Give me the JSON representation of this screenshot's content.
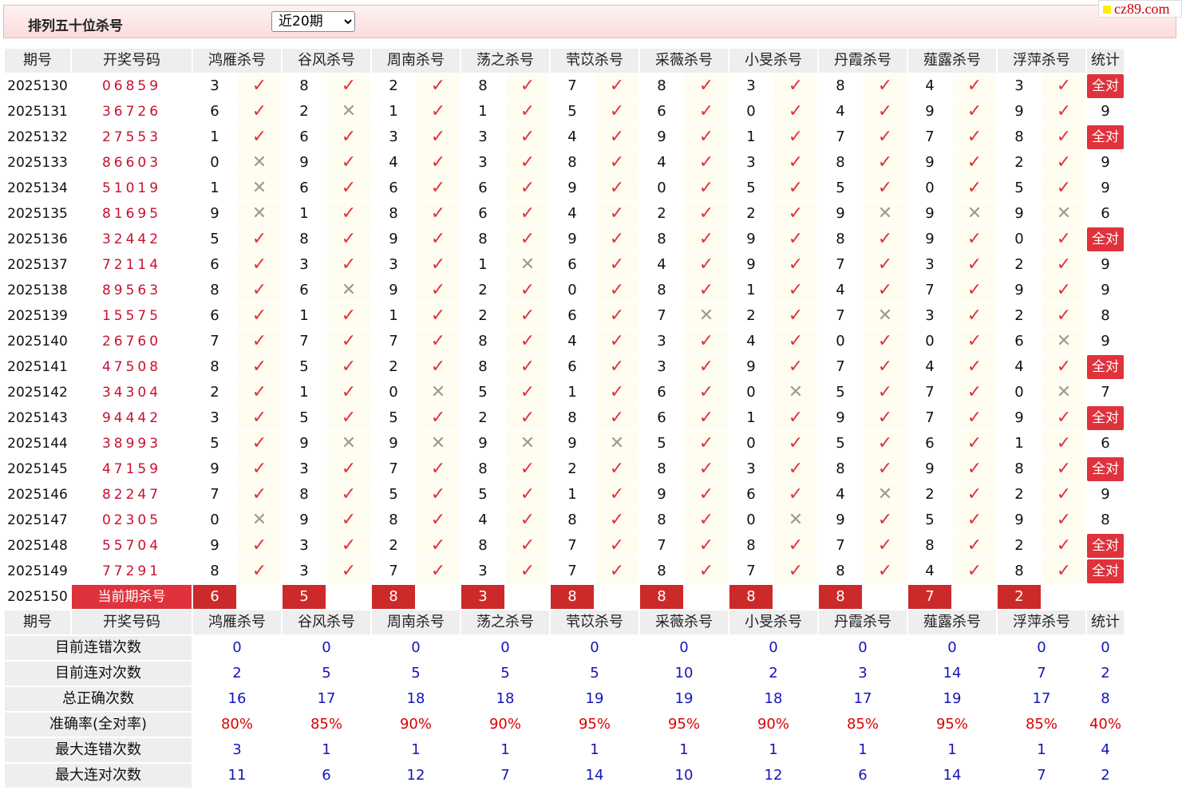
{
  "page": {
    "title": "排列五十位杀号",
    "select": {
      "value": "近20期",
      "options": [
        "近20期"
      ]
    },
    "brand": "cz89.com"
  },
  "headers": [
    "期号",
    "开奖号码",
    "鸿雁杀号",
    "谷风杀号",
    "周南杀号",
    "荡之杀号",
    "茕苡杀号",
    "采薇杀号",
    "小旻杀号",
    "丹霞杀号",
    "薤露杀号",
    "浮萍杀号",
    "统计"
  ],
  "current_label": "当前期杀号",
  "all_ok_label": "全对",
  "marks": {
    "ok": "✓",
    "ng": "✕"
  },
  "colors": {
    "accent": "#e0323c",
    "stat_blue": "#1515b8",
    "rate_red": "#dd0000"
  },
  "rows": [
    {
      "period": "2025130",
      "draw": "06859",
      "kills": [
        3,
        8,
        2,
        8,
        7,
        8,
        3,
        8,
        4,
        3
      ],
      "res": "1111111111",
      "stat": "全对"
    },
    {
      "period": "2025131",
      "draw": "36726",
      "kills": [
        6,
        2,
        1,
        1,
        5,
        6,
        0,
        4,
        9,
        9
      ],
      "res": "1011111111",
      "stat": "9"
    },
    {
      "period": "2025132",
      "draw": "27553",
      "kills": [
        1,
        6,
        3,
        3,
        4,
        9,
        1,
        7,
        7,
        8
      ],
      "res": "1111111111",
      "stat": "全对"
    },
    {
      "period": "2025133",
      "draw": "86603",
      "kills": [
        0,
        9,
        4,
        3,
        8,
        4,
        3,
        8,
        9,
        2
      ],
      "res": "0111111111",
      "stat": "9"
    },
    {
      "period": "2025134",
      "draw": "51019",
      "kills": [
        1,
        6,
        6,
        6,
        9,
        0,
        5,
        5,
        0,
        5
      ],
      "res": "0111111111",
      "stat": "9"
    },
    {
      "period": "2025135",
      "draw": "81695",
      "kills": [
        9,
        1,
        8,
        6,
        4,
        2,
        2,
        9,
        9,
        9
      ],
      "res": "0111111000",
      "stat": "6"
    },
    {
      "period": "2025136",
      "draw": "32442",
      "kills": [
        5,
        8,
        9,
        8,
        9,
        8,
        9,
        8,
        9,
        0
      ],
      "res": "1111111111",
      "stat": "全对"
    },
    {
      "period": "2025137",
      "draw": "72114",
      "kills": [
        6,
        3,
        3,
        1,
        6,
        4,
        9,
        7,
        3,
        2
      ],
      "res": "1110111111",
      "stat": "9"
    },
    {
      "period": "2025138",
      "draw": "89563",
      "kills": [
        8,
        6,
        9,
        2,
        0,
        8,
        1,
        4,
        7,
        9
      ],
      "res": "1011111111",
      "stat": "9"
    },
    {
      "period": "2025139",
      "draw": "15575",
      "kills": [
        6,
        1,
        1,
        2,
        6,
        7,
        2,
        7,
        3,
        2
      ],
      "res": "1111101011",
      "stat": "8"
    },
    {
      "period": "2025140",
      "draw": "26760",
      "kills": [
        7,
        7,
        7,
        8,
        4,
        3,
        4,
        0,
        0,
        6
      ],
      "res": "1111111110",
      "stat": "9"
    },
    {
      "period": "2025141",
      "draw": "47508",
      "kills": [
        8,
        5,
        2,
        8,
        6,
        3,
        9,
        7,
        4,
        4
      ],
      "res": "1111111111",
      "stat": "全对"
    },
    {
      "period": "2025142",
      "draw": "34304",
      "kills": [
        2,
        1,
        0,
        5,
        1,
        6,
        0,
        5,
        7,
        0
      ],
      "res": "1101110110",
      "stat": "7"
    },
    {
      "period": "2025143",
      "draw": "94442",
      "kills": [
        3,
        5,
        5,
        2,
        8,
        6,
        1,
        9,
        7,
        9
      ],
      "res": "1111111111",
      "stat": "全对"
    },
    {
      "period": "2025144",
      "draw": "38993",
      "kills": [
        5,
        9,
        9,
        9,
        9,
        5,
        0,
        5,
        6,
        1
      ],
      "res": "1000011111",
      "stat": "6"
    },
    {
      "period": "2025145",
      "draw": "47159",
      "kills": [
        9,
        3,
        7,
        8,
        2,
        8,
        3,
        8,
        9,
        8
      ],
      "res": "1111111111",
      "stat": "全对"
    },
    {
      "period": "2025146",
      "draw": "82247",
      "kills": [
        7,
        8,
        5,
        5,
        1,
        9,
        6,
        4,
        2,
        2
      ],
      "res": "1111111011",
      "stat": "9"
    },
    {
      "period": "2025147",
      "draw": "02305",
      "kills": [
        0,
        9,
        8,
        4,
        8,
        8,
        0,
        9,
        5,
        9
      ],
      "res": "0111110111",
      "stat": "8"
    },
    {
      "period": "2025148",
      "draw": "55704",
      "kills": [
        9,
        3,
        2,
        8,
        7,
        7,
        8,
        7,
        8,
        2
      ],
      "res": "1111111111",
      "stat": "全对"
    },
    {
      "period": "2025149",
      "draw": "77291",
      "kills": [
        8,
        3,
        7,
        3,
        7,
        8,
        7,
        8,
        4,
        8
      ],
      "res": "1111111111",
      "stat": "全对"
    }
  ],
  "current": {
    "period": "2025150",
    "kills": [
      6,
      5,
      8,
      3,
      8,
      8,
      8,
      8,
      7,
      2
    ]
  },
  "stats": [
    {
      "label": "目前连错次数",
      "values": [
        "0",
        "0",
        "0",
        "0",
        "0",
        "0",
        "0",
        "0",
        "0",
        "0",
        "0"
      ],
      "style": "blue"
    },
    {
      "label": "目前连对次数",
      "values": [
        "2",
        "5",
        "5",
        "5",
        "5",
        "10",
        "2",
        "3",
        "14",
        "7",
        "2"
      ],
      "style": "blue"
    },
    {
      "label": "总正确次数",
      "values": [
        "16",
        "17",
        "18",
        "18",
        "19",
        "19",
        "18",
        "17",
        "19",
        "17",
        "8"
      ],
      "style": "blue"
    },
    {
      "label": "准确率(全对率)",
      "values": [
        "80%",
        "85%",
        "90%",
        "90%",
        "95%",
        "95%",
        "90%",
        "85%",
        "95%",
        "85%",
        "40%"
      ],
      "style": "red"
    },
    {
      "label": "最大连错次数",
      "values": [
        "3",
        "1",
        "1",
        "1",
        "1",
        "1",
        "1",
        "1",
        "1",
        "1",
        "4"
      ],
      "style": "blue"
    },
    {
      "label": "最大连对次数",
      "values": [
        "11",
        "6",
        "12",
        "7",
        "14",
        "10",
        "12",
        "6",
        "14",
        "7",
        "2"
      ],
      "style": "blue"
    }
  ]
}
